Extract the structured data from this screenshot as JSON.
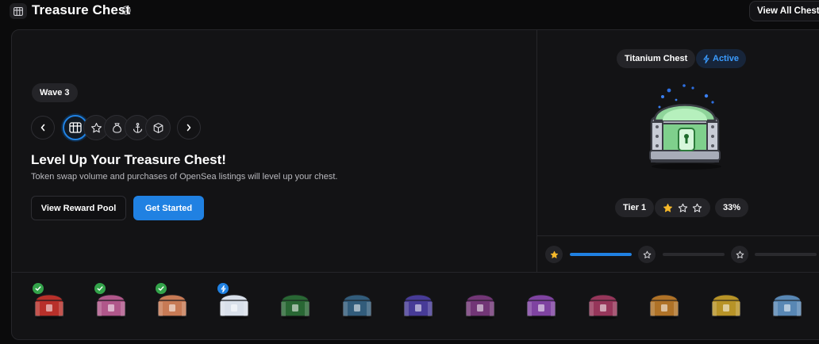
{
  "header": {
    "title": "Treasure Chest",
    "view_all_label": "View All Chests",
    "icons": [
      "grid-chest-icon",
      "info-icon"
    ]
  },
  "left": {
    "wave_label": "Wave 3",
    "categories": [
      {
        "icon": "chest-grid-icon",
        "active": true
      },
      {
        "icon": "star-icon",
        "active": false
      },
      {
        "icon": "money-bag-icon",
        "active": false
      },
      {
        "icon": "anchor-icon",
        "active": false
      },
      {
        "icon": "cube-icon",
        "active": false
      }
    ],
    "title": "Level Up Your Treasure Chest!",
    "subtitle": "Token swap volume and purchases of OpenSea listings will level up your chest.",
    "reward_pool_label": "View Reward Pool",
    "get_started_label": "Get Started"
  },
  "right": {
    "chest_name": "Titanium Chest",
    "status_label": "Active",
    "tier_label": "Tier 1",
    "stars_filled": 1,
    "stars_total": 3,
    "percent_label": "33%",
    "progress": [
      1.0,
      0.0,
      0.0
    ]
  },
  "strip": {
    "chests": [
      {
        "color": "#b8302a",
        "badge": "check"
      },
      {
        "color": "#b0578a",
        "badge": "check"
      },
      {
        "color": "#c77a55",
        "badge": "check"
      },
      {
        "color": "#d9e0ea",
        "badge": "bolt"
      },
      {
        "color": "#2f7d3c",
        "badge": "none"
      },
      {
        "color": "#3a6f95",
        "badge": "none"
      },
      {
        "color": "#5546b8",
        "badge": "none"
      },
      {
        "color": "#8a3f8f",
        "badge": "none"
      },
      {
        "color": "#9a4fc4",
        "badge": "none"
      },
      {
        "color": "#b73f6c",
        "badge": "none"
      },
      {
        "color": "#d68a2c",
        "badge": "none"
      },
      {
        "color": "#e0b42c",
        "badge": "none"
      },
      {
        "color": "#6aa4dc",
        "badge": "none"
      }
    ]
  },
  "colors": {
    "accent": "#2081e2",
    "star": "#f5b82a",
    "check": "#33a34a",
    "background": "#0b0b0c",
    "card": "#131315"
  }
}
